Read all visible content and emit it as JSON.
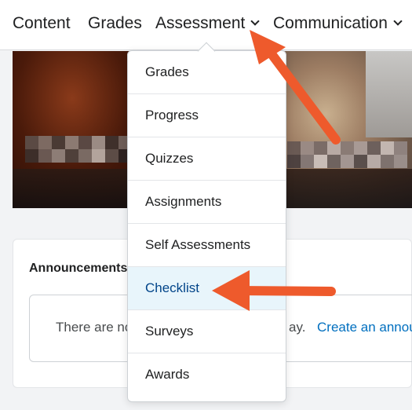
{
  "nav": {
    "items": [
      {
        "label": "Content"
      },
      {
        "label": "Grades"
      },
      {
        "label": "Assessment"
      },
      {
        "label": "Communication"
      }
    ]
  },
  "dropdown": {
    "items": [
      {
        "label": "Grades"
      },
      {
        "label": "Progress"
      },
      {
        "label": "Quizzes"
      },
      {
        "label": "Assignments"
      },
      {
        "label": "Self Assessments"
      },
      {
        "label": "Checklist"
      },
      {
        "label": "Surveys"
      },
      {
        "label": "Awards"
      }
    ]
  },
  "announcements": {
    "title": "Announcements",
    "empty_text_start": "There are no",
    "empty_text_end": "ay.",
    "create_link": "Create an annou"
  },
  "colors": {
    "annotation_arrow": "#ee5a2c",
    "highlight_bg": "#e8f5fb",
    "link": "#006fbf"
  }
}
